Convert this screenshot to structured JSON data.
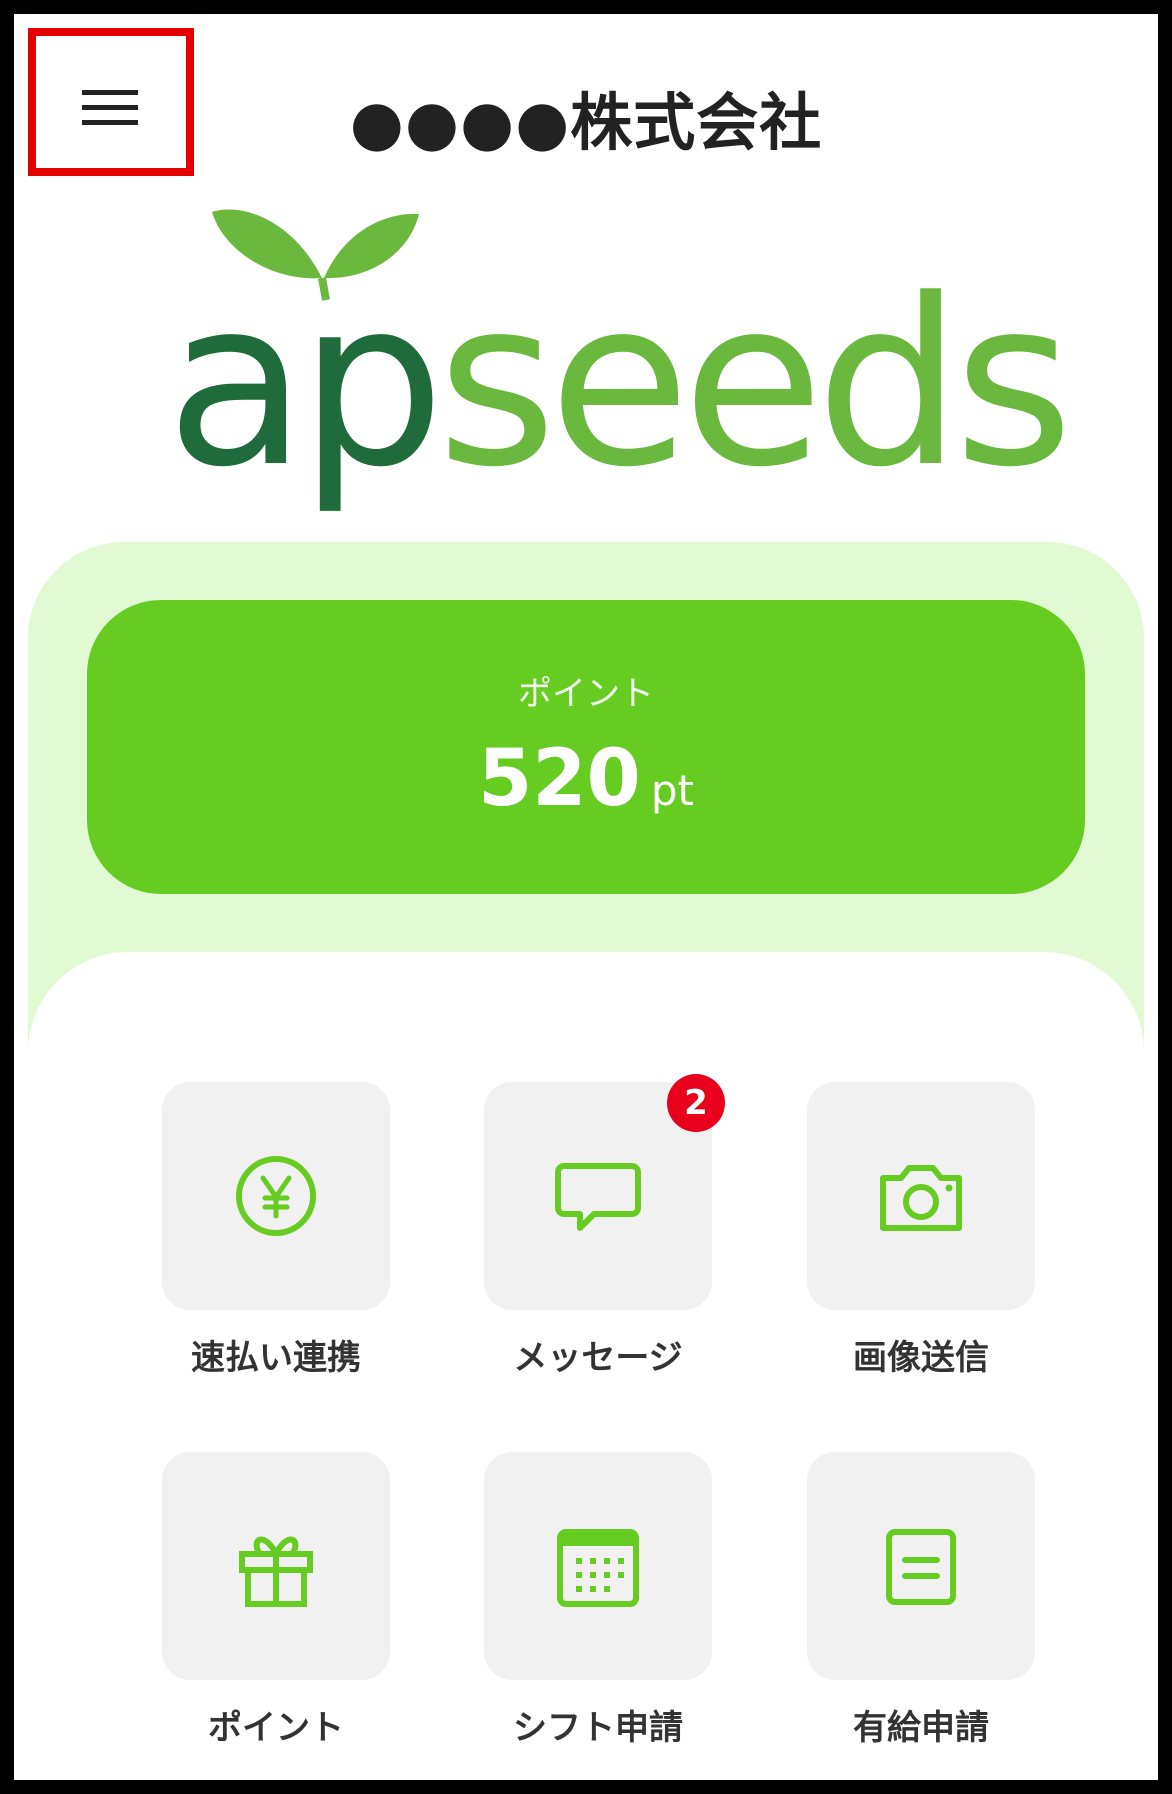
{
  "header": {
    "company_name": "●●●●株式会社",
    "menu_icon": "hamburger-menu-icon"
  },
  "logo": {
    "part1": "ap",
    "part2": "seeds"
  },
  "points": {
    "label": "ポイント",
    "value": "520",
    "unit": "pt"
  },
  "menu": {
    "items": [
      {
        "label": "速払い連携",
        "icon": "yen-coin-icon"
      },
      {
        "label": "メッセージ",
        "icon": "chat-bubble-icon",
        "badge": "2"
      },
      {
        "label": "画像送信",
        "icon": "camera-icon"
      },
      {
        "label": "ポイント",
        "icon": "gift-icon"
      },
      {
        "label": "シフト申請",
        "icon": "calendar-icon"
      },
      {
        "label": "有給申請",
        "icon": "document-icon"
      }
    ]
  },
  "colors": {
    "accent_green": "#66cc21",
    "logo_dark_green": "#1f6b3b",
    "logo_light_green": "#6ab93e",
    "band_bg": "#e2fad4",
    "badge_red": "#e8001c",
    "highlight_red": "#e50000"
  }
}
